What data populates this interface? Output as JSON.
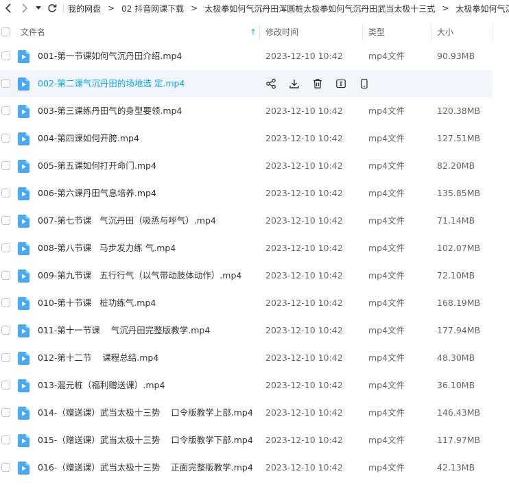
{
  "nav": {
    "back_icon": "chevron-left-icon",
    "forward_icon": "chevron-right-icon",
    "history_icon": "caret-down-icon",
    "refresh_icon": "refresh-icon",
    "breadcrumbs": [
      "我的网盘",
      "02 抖音网课下载",
      "太极拳如何气沉丹田浑圆桩太极拳如何气沉丹田武当太极十三式",
      "太极拳如何气沉"
    ],
    "separator": ">"
  },
  "header": {
    "name": "文件名",
    "sort_icon": "↑",
    "mtime": "修改时间",
    "type": "类型",
    "size": "大小"
  },
  "colors": {
    "accent": "#06a7ff",
    "file_icon": "#4aa7f5",
    "hover_bg": "#f2f5fa"
  },
  "hover_row_index": 1,
  "hover_actions": [
    "share-icon",
    "download-icon",
    "delete-icon",
    "rename-icon",
    "phone-icon"
  ],
  "files": [
    {
      "name": "001-第一节课如何气沉丹田介绍.mp4",
      "mtime": "2023-12-10 10:42",
      "type": "mp4文件",
      "size": "90.93MB"
    },
    {
      "name": "002-第二课气沉丹田的场地选 定.mp4",
      "mtime": "2023-12-10 10:42",
      "type": "mp4文件",
      "size": ""
    },
    {
      "name": "003-第三课练丹田气的身型要领.mp4",
      "mtime": "2023-12-10 10:42",
      "type": "mp4文件",
      "size": "120.38MB"
    },
    {
      "name": "004-第四课如何开胯.mp4",
      "mtime": "2023-12-10 10:42",
      "type": "mp4文件",
      "size": "127.51MB"
    },
    {
      "name": "005-第五课如何打开命门.mp4",
      "mtime": "2023-12-10 10:42",
      "type": "mp4文件",
      "size": "82.20MB"
    },
    {
      "name": "006-第六课丹田气息培养.mp4",
      "mtime": "2023-12-10 10:42",
      "type": "mp4文件",
      "size": "135.85MB"
    },
    {
      "name": "007-第七节课   气沉丹田（吸烝与呼气）.mp4",
      "mtime": "2023-12-10 10:42",
      "type": "mp4文件",
      "size": "71.14MB"
    },
    {
      "name": "008-第八节课   马步发力练 气.mp4",
      "mtime": "2023-12-10 10:42",
      "type": "mp4文件",
      "size": "102.07MB"
    },
    {
      "name": "009-第九节课   五行行气（以气带动肢体动作）.mp4",
      "mtime": "2023-12-10 10:42",
      "type": "mp4文件",
      "size": "72.10MB"
    },
    {
      "name": "010-第十节课   桩功练气.mp4",
      "mtime": "2023-12-10 10:42",
      "type": "mp4文件",
      "size": "168.19MB"
    },
    {
      "name": "011-第十一节课    气沉丹田完整版教学.mp4",
      "mtime": "2023-12-10 10:42",
      "type": "mp4文件",
      "size": "177.94MB"
    },
    {
      "name": "012-第十二节    课程总结.mp4",
      "mtime": "2023-12-10 10:42",
      "type": "mp4文件",
      "size": "48.30MB"
    },
    {
      "name": "013-混元桩（福利赠送课）.mp4",
      "mtime": "2023-12-10 10:42",
      "type": "mp4文件",
      "size": "36.10MB"
    },
    {
      "name": "014-（赠送课）武当太极十三势    口令版教学上部.mp4",
      "mtime": "2023-12-10 10:42",
      "type": "mp4文件",
      "size": "146.43MB"
    },
    {
      "name": "015-（赠送课）武当太极十三势    口令版教学下部.mp4",
      "mtime": "2023-12-10 10:42",
      "type": "mp4文件",
      "size": "117.97MB"
    },
    {
      "name": "016-（赠送课）武当太极十三势    正面完整版教学.mp4",
      "mtime": "2023-12-10 10:42",
      "type": "mp4文件",
      "size": "42.13MB"
    }
  ]
}
